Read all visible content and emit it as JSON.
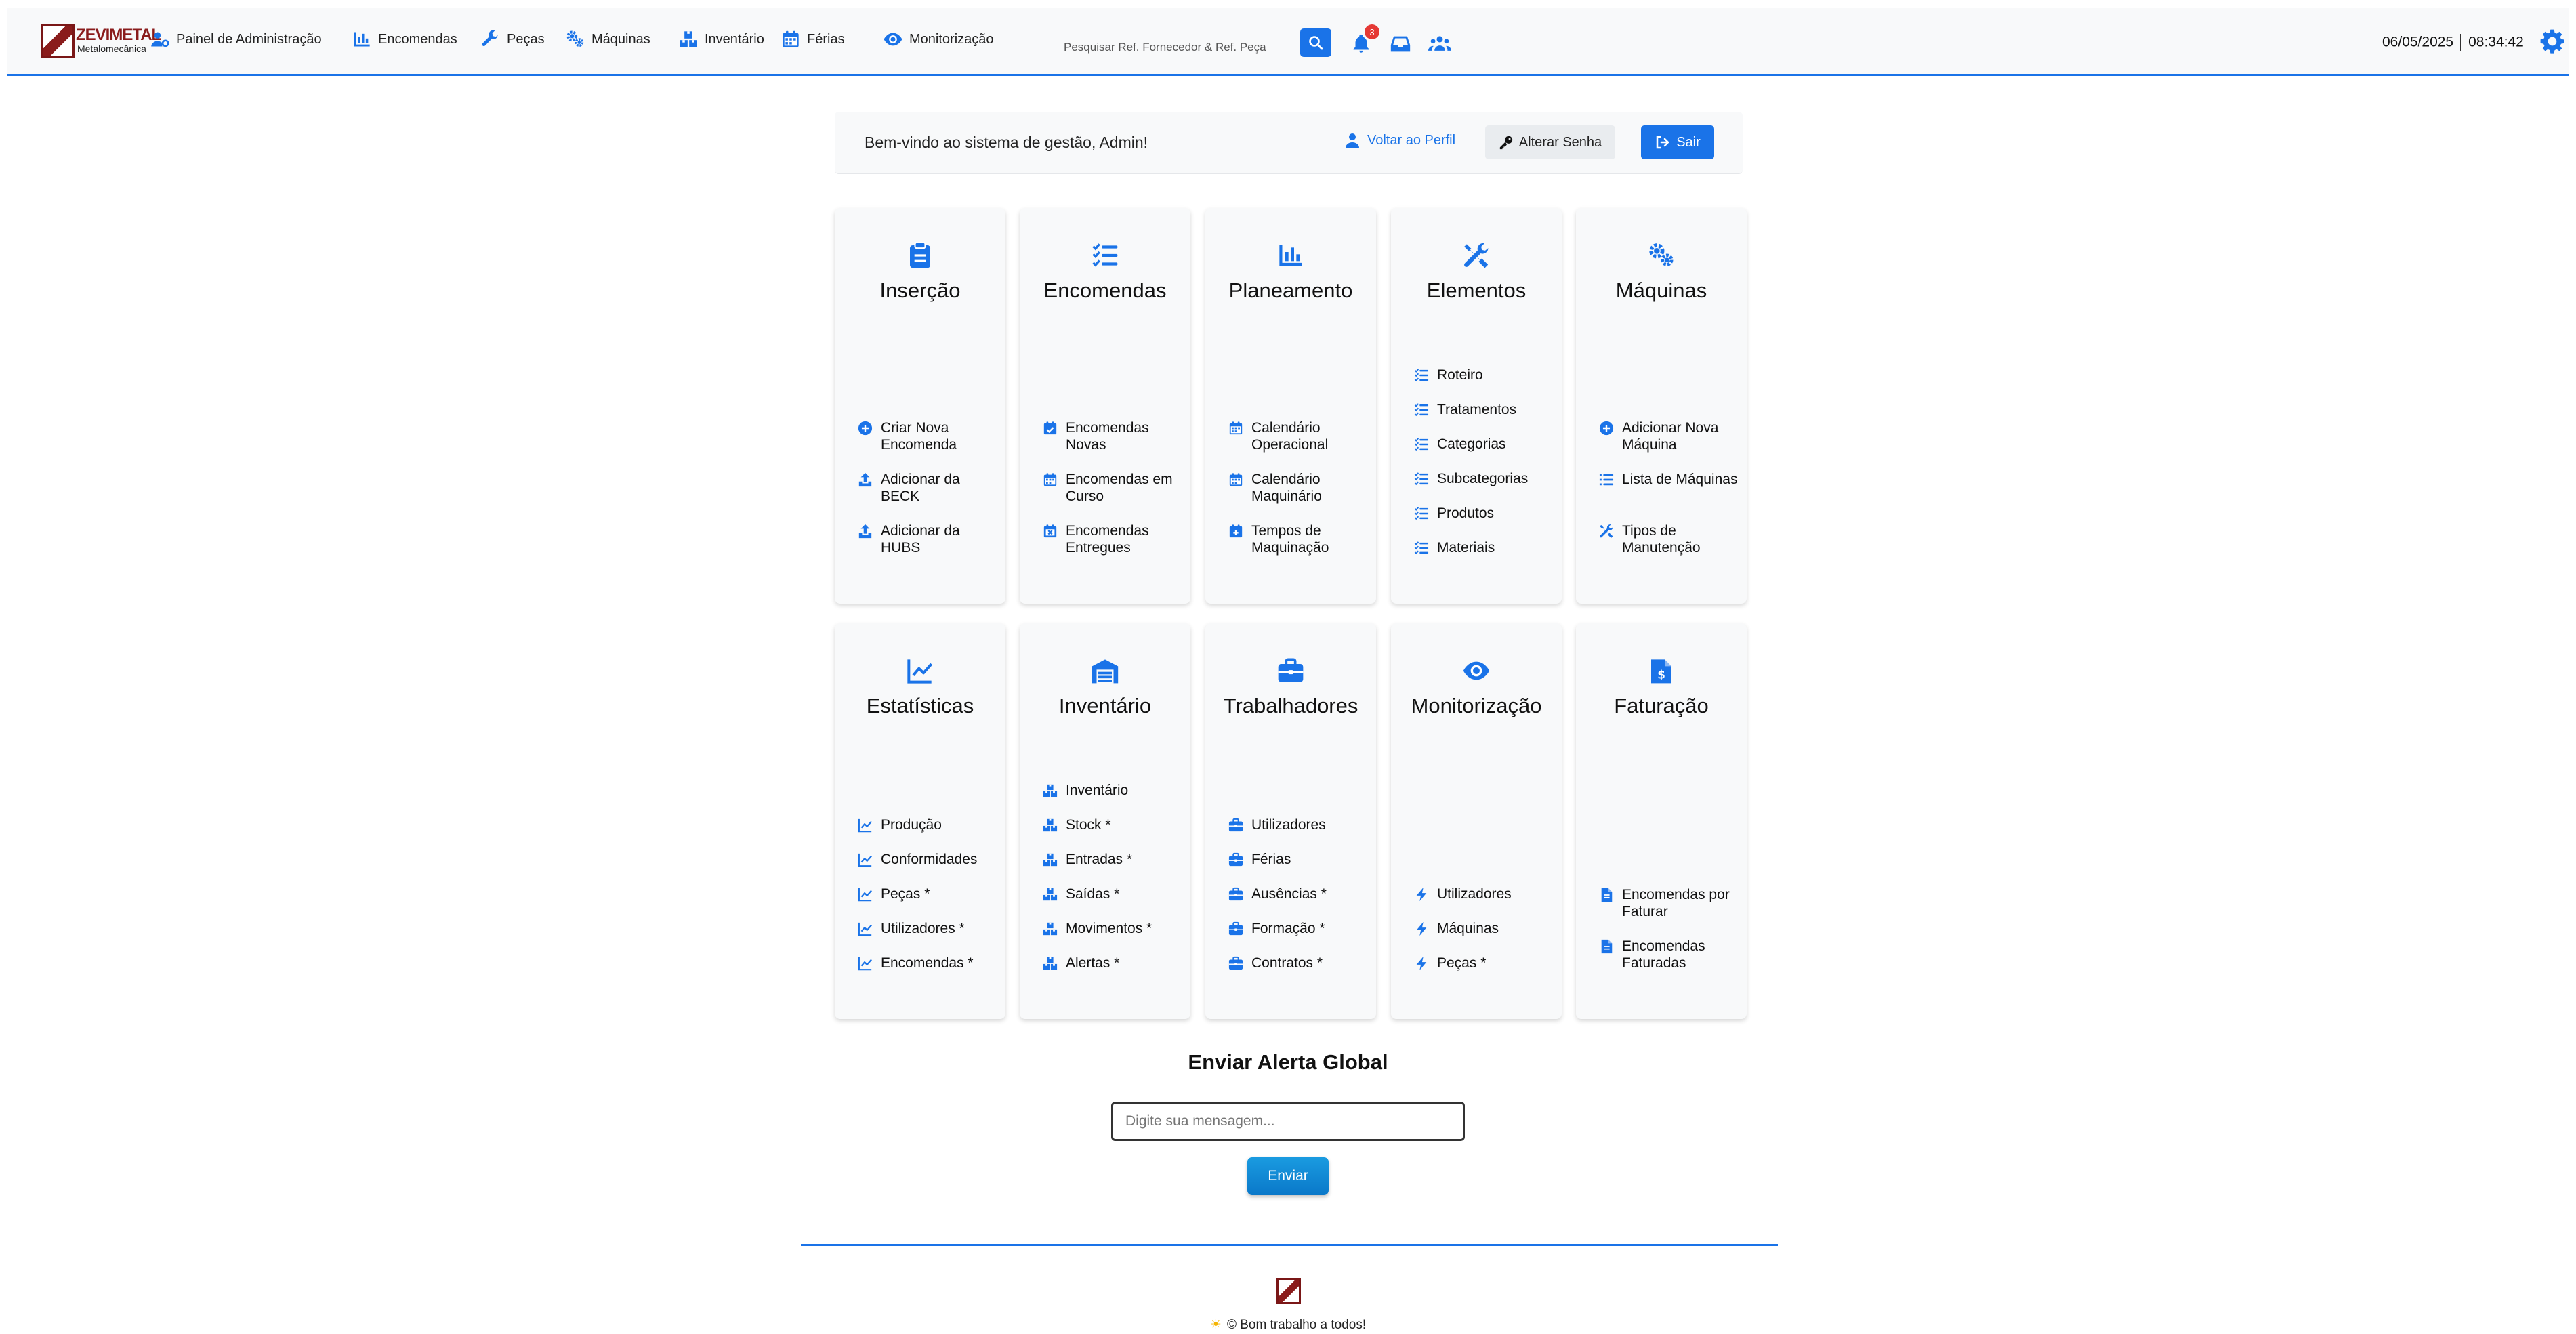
{
  "brand": {
    "name": "ZEVIMETAL",
    "subtitle": "Metalomecânica"
  },
  "nav": [
    {
      "label": "Painel de Administração",
      "icon": "user-gear-icon"
    },
    {
      "label": "Encomendas",
      "icon": "chart-bar-icon"
    },
    {
      "label": "Peças",
      "icon": "wrench-icon"
    },
    {
      "label": "Máquinas",
      "icon": "gears-icon"
    },
    {
      "label": "Inventário",
      "icon": "boxes-icon"
    },
    {
      "label": "Férias",
      "icon": "calendar-icon"
    },
    {
      "label": "Monitorização",
      "icon": "eye-icon"
    }
  ],
  "search": {
    "placeholder": "Pesquisar Ref. Fornecedor & Ref. Peça"
  },
  "notifications": {
    "count": "3"
  },
  "datetime": {
    "date": "06/05/2025",
    "time": "08:34:42"
  },
  "welcome": {
    "text": "Bem-vindo ao sistema de gestão, Admin!",
    "profile": "Voltar ao Perfil",
    "password": "Alterar Senha",
    "exit": "Sair"
  },
  "cards": [
    {
      "title": "Inserção",
      "icon": "clipboard-icon",
      "items": [
        {
          "label": "Criar Nova Encomenda",
          "icon": "plus-circle-icon"
        },
        {
          "label": "Adicionar da BECK",
          "icon": "upload-icon"
        },
        {
          "label": "Adicionar da HUBS",
          "icon": "upload-icon"
        }
      ]
    },
    {
      "title": "Encomendas",
      "icon": "list-check-icon",
      "items": [
        {
          "label": "Encomendas Novas",
          "icon": "calendar-check-icon"
        },
        {
          "label": "Encomendas em Curso",
          "icon": "calendar-icon"
        },
        {
          "label": "Encomendas Entregues",
          "icon": "calendar-x-icon"
        }
      ]
    },
    {
      "title": "Planeamento",
      "icon": "chart-bar-icon",
      "items": [
        {
          "label": "Calendário Operacional",
          "icon": "calendar-icon"
        },
        {
          "label": "Calendário Maquinário",
          "icon": "calendar-icon"
        },
        {
          "label": "Tempos de Maquinação",
          "icon": "calendar-plus-icon"
        }
      ]
    },
    {
      "title": "Elementos",
      "icon": "tools-icon",
      "items": [
        {
          "label": "Roteiro",
          "icon": "list-check-icon"
        },
        {
          "label": "Tratamentos",
          "icon": "list-check-icon"
        },
        {
          "label": "Categorias",
          "icon": "list-check-icon"
        },
        {
          "label": "Subcategorias",
          "icon": "list-check-icon"
        },
        {
          "label": "Produtos",
          "icon": "list-check-icon"
        },
        {
          "label": "Materiais",
          "icon": "list-check-icon"
        }
      ]
    },
    {
      "title": "Máquinas",
      "icon": "gears-icon",
      "items": [
        {
          "label": "Adicionar Nova Máquina",
          "icon": "plus-circle-icon"
        },
        {
          "label": "Lista de Máquinas",
          "icon": "list-icon"
        },
        {
          "label": "Tipos de Manutenção",
          "icon": "tools-icon"
        }
      ]
    },
    {
      "title": "Estatísticas",
      "icon": "chart-line-icon",
      "items": [
        {
          "label": "Produção",
          "icon": "chart-line-icon"
        },
        {
          "label": "Conformidades",
          "icon": "chart-line-icon"
        },
        {
          "label": "Peças *",
          "icon": "chart-line-icon"
        },
        {
          "label": "Utilizadores *",
          "icon": "chart-line-icon"
        },
        {
          "label": "Encomendas *",
          "icon": "chart-line-icon"
        }
      ]
    },
    {
      "title": "Inventário",
      "icon": "warehouse-icon",
      "items": [
        {
          "label": "Inventário",
          "icon": "boxes-icon"
        },
        {
          "label": "Stock *",
          "icon": "boxes-icon"
        },
        {
          "label": "Entradas *",
          "icon": "boxes-icon"
        },
        {
          "label": "Saídas *",
          "icon": "boxes-icon"
        },
        {
          "label": "Movimentos *",
          "icon": "boxes-icon"
        },
        {
          "label": "Alertas *",
          "icon": "boxes-icon"
        }
      ]
    },
    {
      "title": "Trabalhadores",
      "icon": "briefcase-icon",
      "items": [
        {
          "label": "Utilizadores",
          "icon": "briefcase-icon"
        },
        {
          "label": "Férias",
          "icon": "briefcase-icon"
        },
        {
          "label": "Ausências *",
          "icon": "briefcase-icon"
        },
        {
          "label": "Formação *",
          "icon": "briefcase-icon"
        },
        {
          "label": "Contratos *",
          "icon": "briefcase-icon"
        }
      ]
    },
    {
      "title": "Monitorização",
      "icon": "eye-icon",
      "items": [
        {
          "label": "Utilizadores",
          "icon": "bolt-icon"
        },
        {
          "label": "Máquinas",
          "icon": "bolt-icon"
        },
        {
          "label": "Peças *",
          "icon": "bolt-icon"
        }
      ]
    },
    {
      "title": "Faturação",
      "icon": "invoice-dollar-icon",
      "items": [
        {
          "label": "Encomendas por Faturar",
          "icon": "file-icon"
        },
        {
          "label": "Encomendas Faturadas",
          "icon": "file-icon"
        }
      ]
    }
  ],
  "alert": {
    "title": "Enviar Alerta Global",
    "placeholder": "Digite sua mensagem...",
    "button": "Enviar"
  },
  "footer": {
    "text": "© Bom trabalho a todos!"
  },
  "colors": {
    "accent": "#1a73e8",
    "brand": "#8a1c1c",
    "badge": "#e53935"
  }
}
